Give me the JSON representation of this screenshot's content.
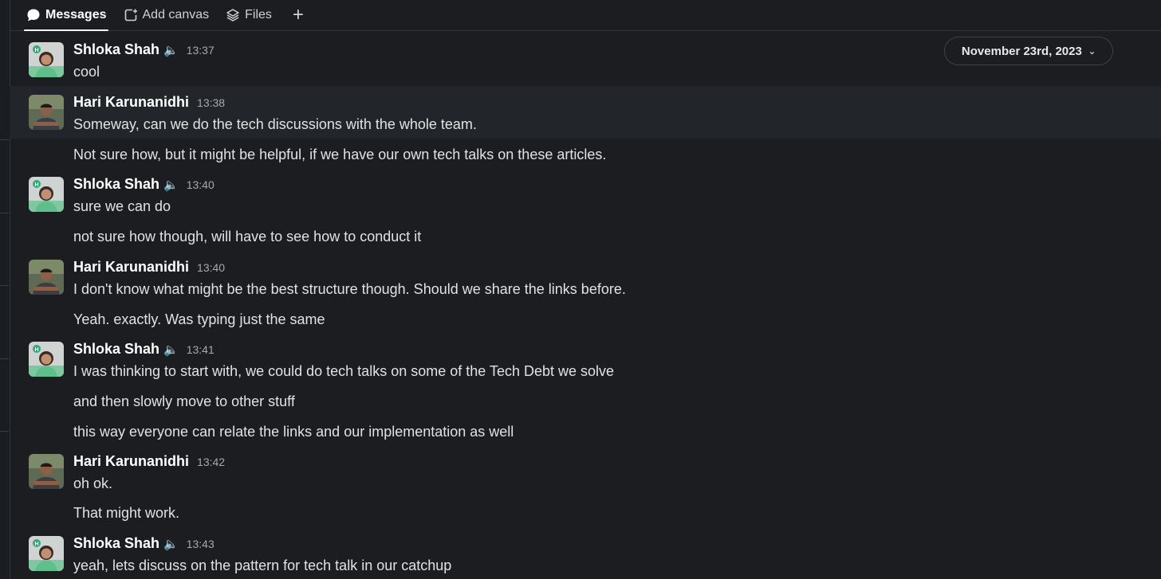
{
  "tabs": [
    {
      "label": "Messages",
      "icon": "chat-bubble-icon",
      "active": true
    },
    {
      "label": "Add canvas",
      "icon": "canvas-icon",
      "active": false
    },
    {
      "label": "Files",
      "icon": "layers-icon",
      "active": false
    }
  ],
  "add_tab_symbol": "+",
  "date_divider": "November 23rd, 2023",
  "messages": [
    {
      "author": "Shloka Shah",
      "speaker": "🔈",
      "time": "13:37",
      "lines": [
        "cool"
      ]
    },
    {
      "author": "Hari Karunanidhi",
      "time": "13:38",
      "lines": [
        "Someway, can we do the tech discussions with the whole team.",
        "Not sure how, but it might be helpful, if we have our own tech talks on these articles."
      ]
    },
    {
      "author": "Shloka Shah",
      "speaker": "🔈",
      "time": "13:40",
      "lines": [
        "sure we can do",
        "not sure how though, will have to see how to conduct it"
      ]
    },
    {
      "author": "Hari Karunanidhi",
      "time": "13:40",
      "lines": [
        "I don't know what might be the best structure though. Should we share the links before.",
        "Yeah. exactly. Was typing just the same"
      ]
    },
    {
      "author": "Shloka Shah",
      "speaker": "🔈",
      "time": "13:41",
      "lines": [
        "I was thinking to start with, we could do tech talks on some of the Tech Debt we solve",
        "and then slowly move to other stuff",
        "this way everyone can relate the links and our implementation as well"
      ]
    },
    {
      "author": "Hari Karunanidhi",
      "time": "13:42",
      "lines": [
        "oh ok.",
        "That might work."
      ]
    },
    {
      "author": "Shloka Shah",
      "speaker": "🔈",
      "time": "13:43",
      "lines": [
        "yeah, lets discuss on the pattern for tech talk in our catchup"
      ]
    }
  ],
  "colors": {
    "background": "#1b1d21",
    "highlight_row": "#222529",
    "accent_green": "#2bac76"
  }
}
